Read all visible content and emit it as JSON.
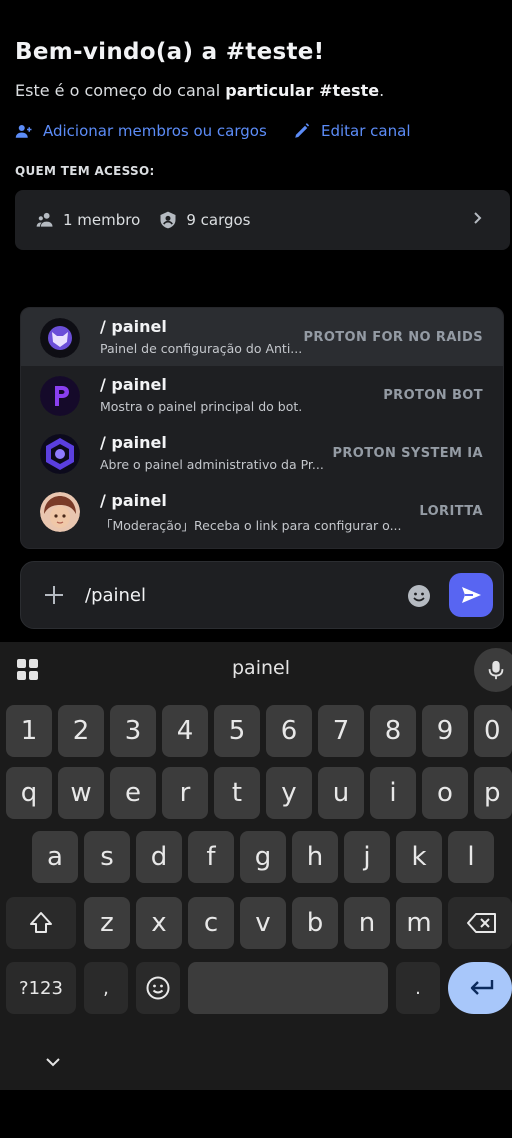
{
  "channel": {
    "welcome_title": "Bem-vindo(a) a #teste!",
    "desc_prefix": "Este é o começo do canal ",
    "desc_bold": "particular #teste",
    "desc_suffix": ".",
    "add_members_label": "Adicionar membros ou cargos",
    "edit_channel_label": "Editar canal",
    "access_label": "QUEM TEM ACESSO:",
    "members_count": "1 membro",
    "roles_count": "9 cargos"
  },
  "suggestions": [
    {
      "command": "/ painel",
      "description": "Painel de configuração do Anti...",
      "bot": "PROTON FOR NO RAIDS",
      "active": true
    },
    {
      "command": "/ painel",
      "description": "Mostra o painel principal do bot.",
      "bot": "PROTON BOT",
      "active": false
    },
    {
      "command": "/ painel",
      "description": "Abre o painel administrativo da Pr...",
      "bot": "PROTON SYSTEM IA",
      "active": false
    },
    {
      "command": "/ painel",
      "description": "「Moderação」Receba o link para configurar o...",
      "bot": "LORITTA",
      "active": false
    }
  ],
  "composer": {
    "value": "/painel"
  },
  "keyboard": {
    "suggestion": "painel",
    "row_numbers": [
      "1",
      "2",
      "3",
      "4",
      "5",
      "6",
      "7",
      "8",
      "9",
      "0"
    ],
    "row_top": [
      "q",
      "w",
      "e",
      "r",
      "t",
      "y",
      "u",
      "i",
      "o",
      "p"
    ],
    "row_mid": [
      "a",
      "s",
      "d",
      "f",
      "g",
      "h",
      "j",
      "k",
      "l"
    ],
    "row_bottom": [
      "z",
      "x",
      "c",
      "v",
      "b",
      "n",
      "m"
    ],
    "symbols_label": "?123",
    "comma": ",",
    "period": "."
  },
  "colors": {
    "accent": "#5865f2",
    "link": "#5c8cf7",
    "enter_key": "#a8c7fa"
  }
}
